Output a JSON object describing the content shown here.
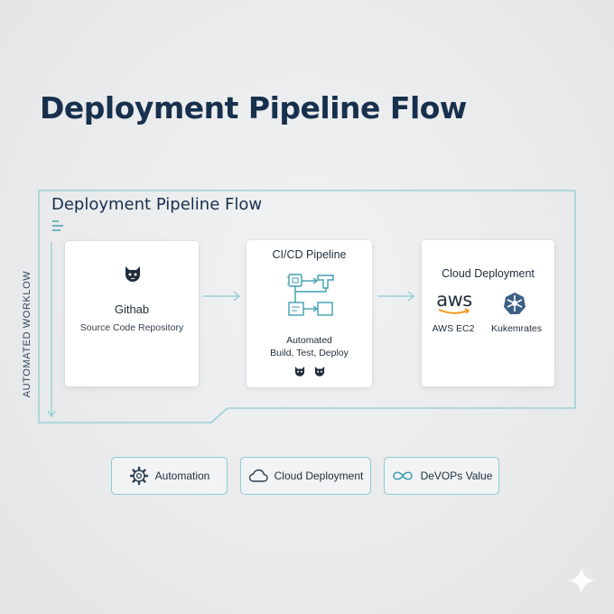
{
  "title": "Deployment Pipeline Flow",
  "frame": {
    "title": "Deployment Pipeline Flow",
    "vertical_label": "AUTOMATED WORKLOW"
  },
  "cards": {
    "source": {
      "icon": "cat-icon",
      "title": "Githab",
      "subtitle": "Source Code Repository"
    },
    "cicd": {
      "icon": "pipeline-flow-icon",
      "title": "CI/CD Pipeline",
      "desc_line1": "Automated",
      "desc_line2": "Build, Test, Deploy",
      "footer_icons": [
        "cat-icon",
        "cat-icon"
      ]
    },
    "cloud": {
      "title": "Cloud Deployment",
      "providers": [
        {
          "name": "AWS EC2",
          "logo_text": "aws",
          "icon": "aws-logo-icon"
        },
        {
          "name": "Kukemrates",
          "icon": "kubernetes-icon"
        }
      ]
    }
  },
  "values": [
    {
      "label": "Automation",
      "icon": "gear-icon"
    },
    {
      "label": "Cloud Deployment",
      "icon": "cloud-icon"
    },
    {
      "label": "DeVOPs Value",
      "icon": "infinity-icon"
    }
  ],
  "colors": {
    "title": "#17304d",
    "accent_teal": "#8ccbd3",
    "text": "#1f2d3b",
    "icon_teal": "#3f9fb0",
    "aws_orange": "#f29a1f"
  }
}
